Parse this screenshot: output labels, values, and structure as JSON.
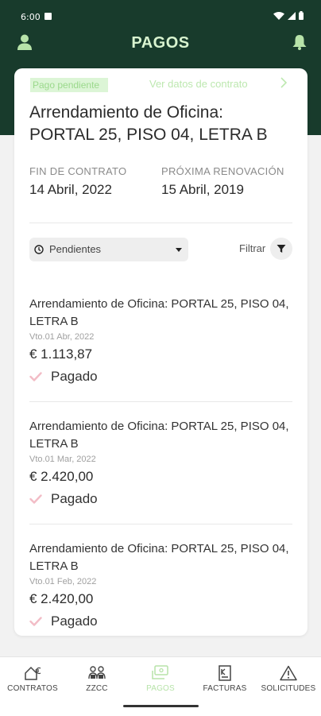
{
  "status_bar": {
    "time": "6:00"
  },
  "header": {
    "title": "PAGOS",
    "user_icon": "user-icon",
    "bell_icon": "bell-icon"
  },
  "contract": {
    "badge": "Pago pendiente",
    "link_text": "Ver datos de contrato",
    "title": "Arrendamiento de Oficina: PORTAL 25, PISO 04, LETRA B",
    "end_label": "FIN DE CONTRATO",
    "end_value": "14 Abril, 2022",
    "renewal_label": "PRÓXIMA RENOVACIÓN",
    "renewal_value": "15 Abril, 2019"
  },
  "filter": {
    "selected": "Pendientes",
    "label": "Filtrar"
  },
  "payments": [
    {
      "name": "Arrendamiento de Oficina: PORTAL 25, PISO 04, LETRA B",
      "due": "Vto.01 Abr, 2022",
      "amount": "€ 1.113,87",
      "status": "Pagado"
    },
    {
      "name": "Arrendamiento de Oficina: PORTAL 25, PISO 04, LETRA B",
      "due": "Vto.01 Mar, 2022",
      "amount": "€ 2.420,00",
      "status": "Pagado"
    },
    {
      "name": "Arrendamiento de Oficina: PORTAL 25, PISO 04, LETRA B",
      "due": "Vto.01 Feb, 2022",
      "amount": "€ 2.420,00",
      "status": "Pagado"
    }
  ],
  "nav": [
    {
      "label": "CONTRATOS",
      "icon": "house-euro-icon"
    },
    {
      "label": "ZZCC",
      "icon": "people-icon"
    },
    {
      "label": "PAGOS",
      "icon": "payments-icon",
      "active": true
    },
    {
      "label": "FACTURAS",
      "icon": "invoice-icon"
    },
    {
      "label": "SOLICITUDES",
      "icon": "warning-icon"
    }
  ],
  "colors": {
    "header_bg": "#183b2c",
    "accent_green": "#b7e3a9",
    "check_pink": "#f2bcc6"
  }
}
